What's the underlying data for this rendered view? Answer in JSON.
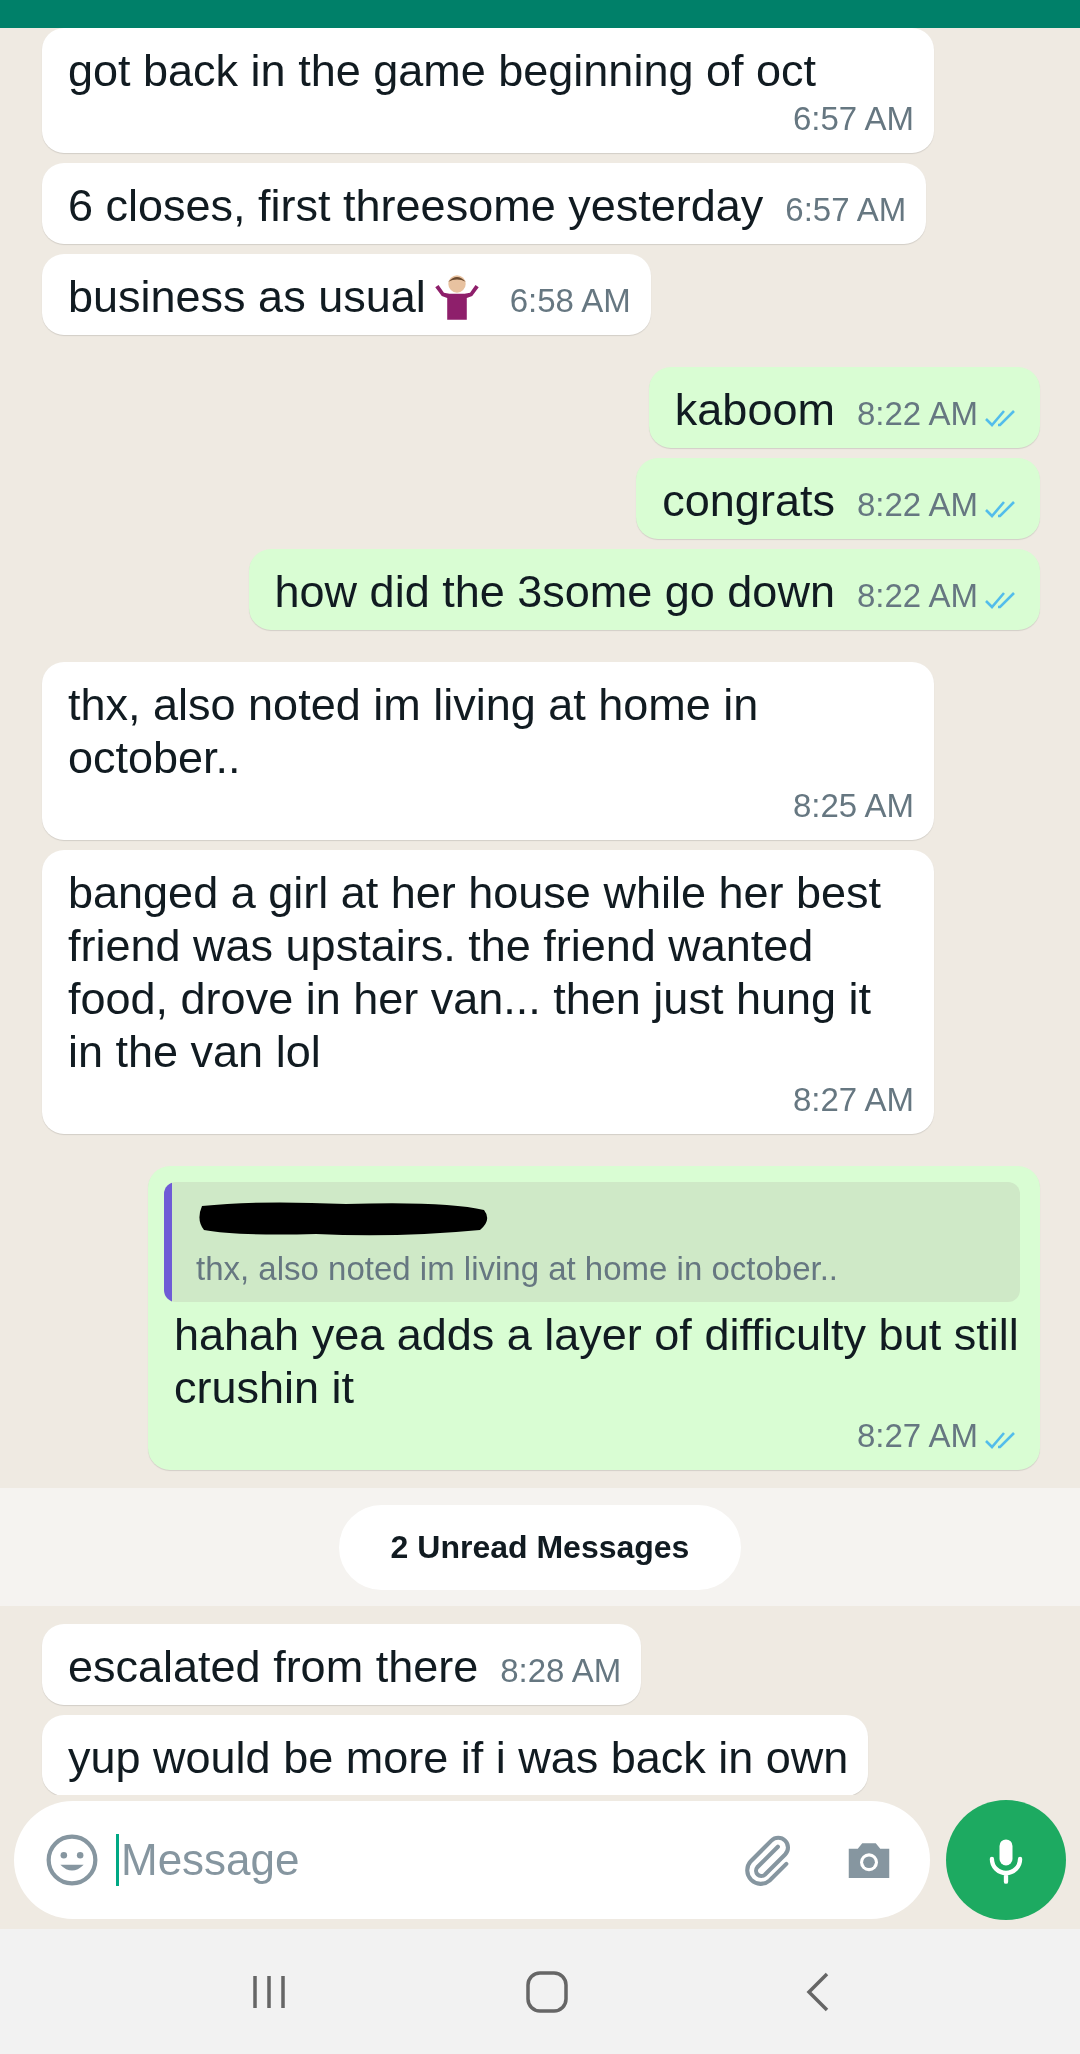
{
  "input": {
    "placeholder": "Message"
  },
  "messages": [
    {
      "kind": "incoming",
      "text": "got back in the game beginning of oct",
      "time": "6:57 AM"
    },
    {
      "kind": "incoming",
      "text": "6 closes, first threesome yesterday",
      "time": "6:57 AM"
    },
    {
      "kind": "incoming",
      "text": "business as usual",
      "time": "6:58 AM",
      "emoji": true
    },
    {
      "kind": "outgoing",
      "text": "kaboom",
      "time": "8:22 AM",
      "read": true
    },
    {
      "kind": "outgoing",
      "text": "congrats",
      "time": "8:22 AM",
      "read": true
    },
    {
      "kind": "outgoing",
      "text": "how did the 3some go down",
      "time": "8:22 AM",
      "read": true
    },
    {
      "kind": "incoming",
      "text": "thx, also noted im living at home in october..",
      "time": "8:25 AM"
    },
    {
      "kind": "incoming",
      "text": "banged a girl at her house while her best friend was upstairs. the friend wanted food, drove in her van... then just hung it in the van lol",
      "time": "8:27 AM"
    },
    {
      "kind": "outgoing",
      "quote": "thx, also noted im living at home in october..",
      "text": "hahah yea adds a layer of difficulty but still crushin it",
      "time": "8:27 AM",
      "read": true
    },
    {
      "kind": "unread",
      "text": "2 Unread Messages"
    },
    {
      "kind": "incoming",
      "text": "escalated from there",
      "time": "8:28 AM"
    },
    {
      "kind": "incoming",
      "text": "yup would be more if i was back in own"
    }
  ]
}
